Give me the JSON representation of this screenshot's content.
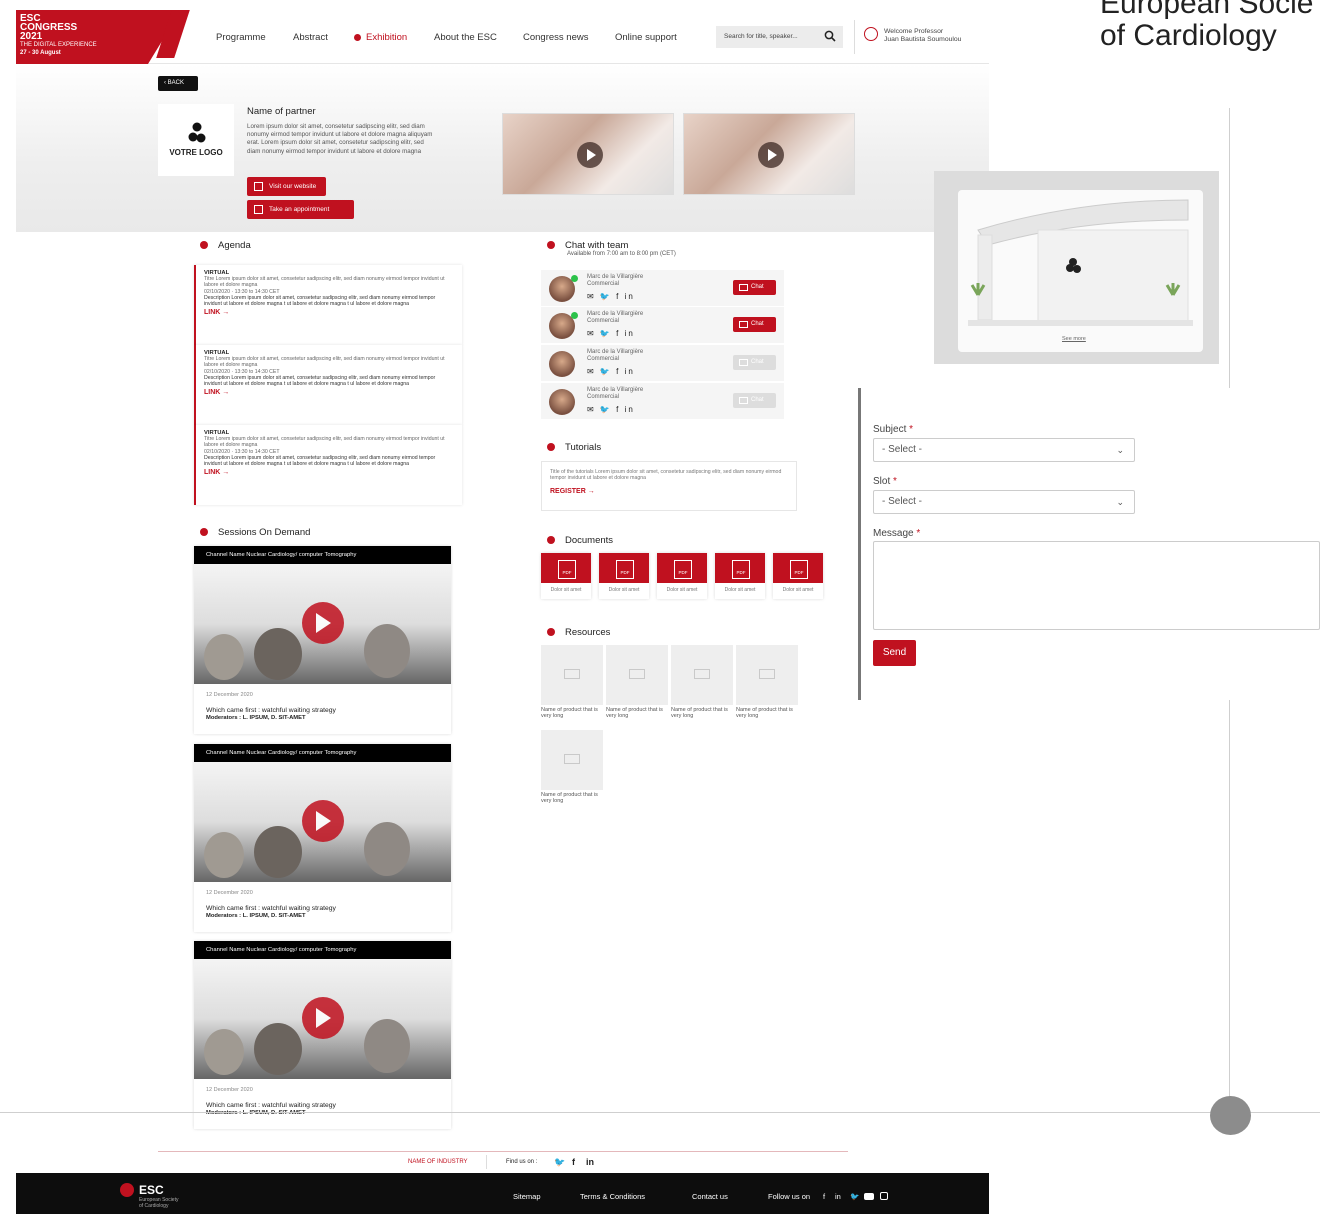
{
  "header": {
    "logo": {
      "line1": "ESC",
      "line2": "CONGRESS",
      "line3": "2021",
      "line4": "THE DIGITAL EXPERIENCE",
      "line5": "27 - 30 August"
    },
    "nav": [
      "Programme",
      "Abstract",
      "Exhibition",
      "About the ESC",
      "Congress news",
      "Online support"
    ],
    "active_nav": "Exhibition",
    "search_placeholder": "Search for title, speaker...",
    "welcome_line1": "Welcome Professor",
    "welcome_line2": "Juan Bautista Soumoulou"
  },
  "hero": {
    "back_label": "BACK",
    "logo_text": "VOTRE LOGO",
    "partner_name": "Name of partner",
    "partner_desc": "Lorem ipsum dolor sit amet, consetetur sadipscing elitr, sed diam nonumy eirmod tempor invidunt ut labore et dolore magna aliquyam erat. Lorem ipsum dolor sit amet, consetetur sadipscing elitr, sed diam nonumy eirmod tempor invidunt ut labore et dolore magna",
    "visit_btn": "Visit our website",
    "appointment_btn": "Take an appointment"
  },
  "agenda": {
    "title": "Agenda",
    "items": [
      {
        "type": "VIRTUAL",
        "title": "Titre Lorem ipsum dolor sit amet, consetetur sadipscing elitr, sed diam nonumy eirmod tempor invidunt ut labore et dolore magna",
        "date": "02/10/2020 · 13:30 to 14:30 CET",
        "desc": "Description Lorem ipsum dolor sit amet, consetetur sadipscing elitr, sed diam nonumy eirmod tempor invidunt ut labore et dolore magna t ut labore et dolore magna t ul labore et dolore magna",
        "link": "LINK →"
      },
      {
        "type": "VIRTUAL",
        "title": "Titre Lorem ipsum dolor sit amet, consetetur sadipscing elitr, sed diam nonumy eirmod tempor invidunt ut labore et dolore magna",
        "date": "02/10/2020 · 13:30 to 14:30 CET",
        "desc": "Description Lorem ipsum dolor sit amet, consetetur sadipscing elitr, sed diam nonumy eirmod tempor invidunt ut labore et dolore magna t ut labore et dolore magna t ul labore et dolore magna",
        "link": "LINK →"
      },
      {
        "type": "VIRTUAL",
        "title": "Titre Lorem ipsum dolor sit amet, consetetur sadipscing elitr, sed diam nonumy eirmod tempor invidunt ut labore et dolore magna",
        "date": "02/10/2020 · 13:30 to 14:30 CET",
        "desc": "Description Lorem ipsum dolor sit amet, consetetur sadipscing elitr, sed diam nonumy eirmod tempor invidunt ut labore et dolore magna t ut labore et dolore magna t ul labore et dolore magna",
        "link": "LINK →"
      }
    ]
  },
  "chat": {
    "title": "Chat with team",
    "subtitle": "Available from 7:00 am to 8:00 pm (CET)",
    "members": [
      {
        "name": "Marc de la Villargière",
        "role": "Commercial",
        "online": true,
        "chat_label": "Chat",
        "enabled": true
      },
      {
        "name": "Marc de la Villargière",
        "role": "Commercial",
        "online": true,
        "chat_label": "Chat",
        "enabled": true
      },
      {
        "name": "Marc de la Villargière",
        "role": "Commercial",
        "online": false,
        "chat_label": "Chat",
        "enabled": false
      },
      {
        "name": "Marc de la Villargière",
        "role": "Commercial",
        "online": false,
        "chat_label": "Chat",
        "enabled": false
      }
    ],
    "social": "✉ 🐦 f in"
  },
  "tutorials": {
    "title": "Tutorials",
    "text": "Title of the tutorials Lorem ipsum dolor sit amet, consetetur sadipscing elitr, sed diam nonumy eirmod tempor invidunt ut labore et dolore magna",
    "link": "REGISTER →"
  },
  "documents": {
    "title": "Documents",
    "items": [
      "Dolor sit amet",
      "Dolor sit amet",
      "Dolor sit amet",
      "Dolor sit amet",
      "Dolor sit amet"
    ]
  },
  "resources": {
    "title": "Resources",
    "items": [
      "Name of product that is very long",
      "Name of product that is very long",
      "Name of product that is very long",
      "Name of product that is very long",
      "Name of product that is very long"
    ]
  },
  "sessions": {
    "title": "Sessions On Demand",
    "items": [
      {
        "channel": "Channel Name Nuclear Cardiology/ computer Tomography",
        "date": "12 December 2020",
        "title": "Which came first : watchful waiting strategy",
        "moderators": "Moderators : L. IPSUM, D. SIT-AMET"
      },
      {
        "channel": "Channel Name Nuclear Cardiology/ computer Tomography",
        "date": "12 December 2020",
        "title": "Which came first : watchful waiting strategy",
        "moderators": "Moderators : L. IPSUM, D. SIT-AMET"
      },
      {
        "channel": "Channel Name Nuclear Cardiology/ computer Tomography",
        "date": "12 December 2020",
        "title": "Which came first : watchful waiting strategy",
        "moderators": "Moderators : L. IPSUM, D. SIT-AMET"
      }
    ]
  },
  "subfooter": {
    "industry": "NAME OF INDUSTRY",
    "find_us": "Find us on :"
  },
  "footer": {
    "brand": "ESC",
    "brand_sub1": "European Society",
    "brand_sub2": "of Cardiology",
    "links": [
      "Sitemap",
      "Terms & Conditions",
      "Contact us"
    ],
    "follow": "Follow us on"
  },
  "side": {
    "brand_line1": "European Socie",
    "brand_line2": "of Cardiology",
    "stand_label": "See more",
    "form": {
      "subject_label": "Subject",
      "slot_label": "Slot",
      "message_label": "Message",
      "required_mark": "*",
      "select_placeholder": "- Select -",
      "send": "Send"
    }
  },
  "colors": {
    "accent": "#c0111f",
    "online": "#2bc24a",
    "footer": "#0d0d0d"
  }
}
